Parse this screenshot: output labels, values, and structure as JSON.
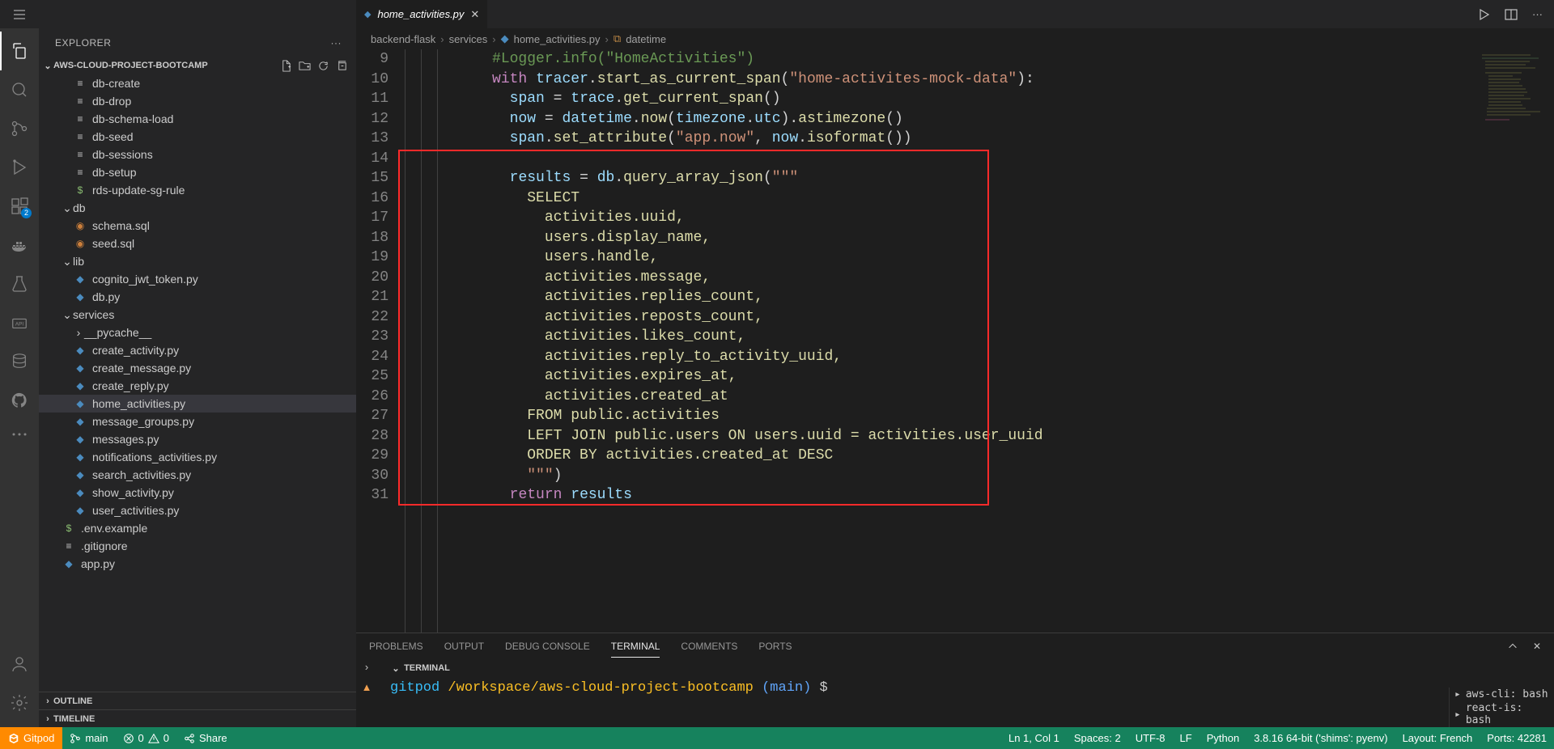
{
  "explorer_title": "EXPLORER",
  "project_name": "AWS-CLOUD-PROJECT-BOOTCAMP",
  "files": [
    {
      "icon": "gen",
      "name": "db-create",
      "indent": 2
    },
    {
      "icon": "gen",
      "name": "db-drop",
      "indent": 2
    },
    {
      "icon": "gen",
      "name": "db-schema-load",
      "indent": 2
    },
    {
      "icon": "gen",
      "name": "db-seed",
      "indent": 2
    },
    {
      "icon": "gen",
      "name": "db-sessions",
      "indent": 2
    },
    {
      "icon": "gen",
      "name": "db-setup",
      "indent": 2
    },
    {
      "icon": "dollar",
      "name": "rds-update-sg-rule",
      "indent": 2
    },
    {
      "icon": "fold",
      "name": "db",
      "indent": 1,
      "open": true
    },
    {
      "icon": "sql",
      "name": "schema.sql",
      "indent": 2
    },
    {
      "icon": "sql",
      "name": "seed.sql",
      "indent": 2
    },
    {
      "icon": "fold",
      "name": "lib",
      "indent": 1,
      "open": true
    },
    {
      "icon": "py",
      "name": "cognito_jwt_token.py",
      "indent": 2
    },
    {
      "icon": "py",
      "name": "db.py",
      "indent": 2
    },
    {
      "icon": "fold",
      "name": "services",
      "indent": 1,
      "open": true
    },
    {
      "icon": "fold",
      "name": "__pycache__",
      "indent": 2,
      "open": false
    },
    {
      "icon": "py",
      "name": "create_activity.py",
      "indent": 2
    },
    {
      "icon": "py",
      "name": "create_message.py",
      "indent": 2
    },
    {
      "icon": "py",
      "name": "create_reply.py",
      "indent": 2
    },
    {
      "icon": "py",
      "name": "home_activities.py",
      "indent": 2,
      "sel": true
    },
    {
      "icon": "py",
      "name": "message_groups.py",
      "indent": 2
    },
    {
      "icon": "py",
      "name": "messages.py",
      "indent": 2
    },
    {
      "icon": "py",
      "name": "notifications_activities.py",
      "indent": 2
    },
    {
      "icon": "py",
      "name": "search_activities.py",
      "indent": 2
    },
    {
      "icon": "py",
      "name": "show_activity.py",
      "indent": 2
    },
    {
      "icon": "py",
      "name": "user_activities.py",
      "indent": 2
    },
    {
      "icon": "dollar",
      "name": ".env.example",
      "indent": 1
    },
    {
      "icon": "gen",
      "name": ".gitignore",
      "indent": 1
    },
    {
      "icon": "py",
      "name": "app.py",
      "indent": 1
    }
  ],
  "outline_label": "OUTLINE",
  "timeline_label": "TIMELINE",
  "tab": {
    "name": "home_activities.py"
  },
  "breadcrumb": [
    "backend-flask",
    "services",
    "home_activities.py",
    "datetime"
  ],
  "code": {
    "first_line": 9,
    "lines": [
      [
        [
          "cm",
          "#Logger.info(\"HomeActivities\")"
        ]
      ],
      [
        [
          "kw",
          "with"
        ],
        [
          "pl",
          " "
        ],
        [
          "id",
          "tracer"
        ],
        [
          "pl",
          "."
        ],
        [
          "fn",
          "start_as_current_span"
        ],
        [
          "pl",
          "("
        ],
        [
          "str",
          "\"home-activites-mock-data\""
        ],
        [
          "pl",
          "):"
        ]
      ],
      [
        [
          "pl",
          "  "
        ],
        [
          "id",
          "span"
        ],
        [
          "pl",
          " "
        ],
        [
          "op",
          "="
        ],
        [
          "pl",
          " "
        ],
        [
          "id",
          "trace"
        ],
        [
          "pl",
          "."
        ],
        [
          "fn",
          "get_current_span"
        ],
        [
          "pl",
          "()"
        ]
      ],
      [
        [
          "pl",
          "  "
        ],
        [
          "id",
          "now"
        ],
        [
          "pl",
          " "
        ],
        [
          "op",
          "="
        ],
        [
          "pl",
          " "
        ],
        [
          "id",
          "datetime"
        ],
        [
          "pl",
          "."
        ],
        [
          "fn",
          "now"
        ],
        [
          "pl",
          "("
        ],
        [
          "id",
          "timezone"
        ],
        [
          "pl",
          "."
        ],
        [
          "id",
          "utc"
        ],
        [
          "pl",
          ")."
        ],
        [
          "fn",
          "astimezone"
        ],
        [
          "pl",
          "()"
        ]
      ],
      [
        [
          "pl",
          "  "
        ],
        [
          "id",
          "span"
        ],
        [
          "pl",
          "."
        ],
        [
          "fn",
          "set_attribute"
        ],
        [
          "pl",
          "("
        ],
        [
          "str",
          "\"app.now\""
        ],
        [
          "pl",
          ", "
        ],
        [
          "id",
          "now"
        ],
        [
          "pl",
          "."
        ],
        [
          "fn",
          "isoformat"
        ],
        [
          "pl",
          "())"
        ]
      ],
      [
        [
          "pl",
          ""
        ]
      ],
      [
        [
          "pl",
          "  "
        ],
        [
          "id",
          "results"
        ],
        [
          "pl",
          " "
        ],
        [
          "op",
          "="
        ],
        [
          "pl",
          " "
        ],
        [
          "id",
          "db"
        ],
        [
          "pl",
          "."
        ],
        [
          "fn",
          "query_array_json"
        ],
        [
          "pl",
          "("
        ],
        [
          "str",
          "\"\"\""
        ]
      ],
      [
        [
          "sql",
          "    SELECT"
        ]
      ],
      [
        [
          "sql",
          "      activities.uuid,"
        ]
      ],
      [
        [
          "sql",
          "      users.display_name,"
        ]
      ],
      [
        [
          "sql",
          "      users.handle,"
        ]
      ],
      [
        [
          "sql",
          "      activities.message,"
        ]
      ],
      [
        [
          "sql",
          "      activities.replies_count,"
        ]
      ],
      [
        [
          "sql",
          "      activities.reposts_count,"
        ]
      ],
      [
        [
          "sql",
          "      activities.likes_count,"
        ]
      ],
      [
        [
          "sql",
          "      activities.reply_to_activity_uuid,"
        ]
      ],
      [
        [
          "sql",
          "      activities.expires_at,"
        ]
      ],
      [
        [
          "sql",
          "      activities.created_at"
        ]
      ],
      [
        [
          "sql",
          "    FROM public.activities"
        ]
      ],
      [
        [
          "sql",
          "    LEFT JOIN public.users ON users.uuid = activities.user_uuid"
        ]
      ],
      [
        [
          "sql",
          "    ORDER BY activities.created_at DESC"
        ]
      ],
      [
        [
          "sql",
          "    "
        ],
        [
          "str",
          "\"\"\""
        ],
        [
          "pl",
          ")"
        ]
      ],
      [
        [
          "pl",
          "  "
        ],
        [
          "kw",
          "return"
        ],
        [
          "pl",
          " "
        ],
        [
          "id",
          "results"
        ]
      ]
    ]
  },
  "panel_tabs": [
    "PROBLEMS",
    "OUTPUT",
    "DEBUG CONSOLE",
    "TERMINAL",
    "COMMENTS",
    "PORTS"
  ],
  "panel_active": "TERMINAL",
  "terminal_label": "TERMINAL",
  "terminal_line": {
    "user": "gitpod",
    "path": "/workspace/aws-cloud-project-bootcamp",
    "branch": "(main)",
    "prompt": "$"
  },
  "task_entries": [
    "aws-cli: bash",
    "react-is: bash"
  ],
  "status": {
    "gitpod": "Gitpod",
    "branch": "main",
    "errors": "0",
    "warnings": "0",
    "share": "Share",
    "pos": "Ln 1, Col 1",
    "spaces": "Spaces: 2",
    "enc": "UTF-8",
    "eol": "LF",
    "lang": "Python",
    "interp": "3.8.16 64-bit ('shims': pyenv)",
    "layout": "Layout: French",
    "ports": "Ports: 42281"
  }
}
